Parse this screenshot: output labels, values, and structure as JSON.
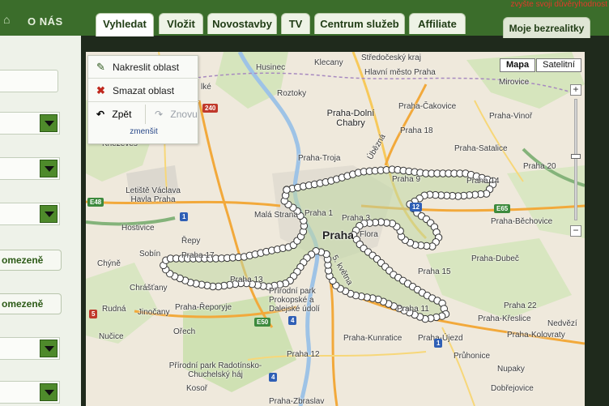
{
  "header": {
    "home_icon": "home-icon",
    "about": "O NÁS",
    "warning": "zvyšte svoji důvěryhodnost",
    "tabs": [
      {
        "label": "Vyhledat",
        "active": true
      },
      {
        "label": "Vložit"
      },
      {
        "label": "Novostavby"
      },
      {
        "label": "TV"
      },
      {
        "label": "Centrum služeb"
      },
      {
        "label": "Affiliate"
      },
      {
        "label": "Moje bezrealitky"
      }
    ]
  },
  "sidebar": {
    "button_1": "omezeně",
    "button_2": "omezeně"
  },
  "draw_panel": {
    "draw": "Nakreslit oblast",
    "delete": "Smazat oblast",
    "undo": "Zpět",
    "redo": "Znovu",
    "shrink": "zmenšit"
  },
  "map_type": {
    "map": "Mapa",
    "satellite": "Satelitní"
  },
  "zoom": {
    "level_fraction": 0.55
  },
  "map_labels": {
    "husinec": "Husinec",
    "klecany": "Klecany",
    "stredocesky": "Středočeský kraj",
    "hlavni_mesto": "Hlavní město Praha",
    "mirovice": "Mirovice",
    "roztoky": "Roztoky",
    "lke": "lké",
    "cakovice": "Praha-Čakovice",
    "dolni_chabry": "Praha-Dolní Chabry",
    "vinor": "Praha-Vinoř",
    "praha18": "Praha 18",
    "knezeves": "Kněževes",
    "troja": "Praha-Troja",
    "satalice": "Praha-Satalice",
    "praha9": "Praha 9",
    "praha14": "Praha 14",
    "praha20": "Praha 20",
    "letiste": "Letiště Václava Havla Praha",
    "mala_strana": "Malá Strana",
    "praha1": "Praha 1",
    "praha3": "Praha 3",
    "hostivice": "Hostivice",
    "praha": "Praha",
    "flora": "Flora",
    "bechovice": "Praha-Běchovice",
    "repy": "Řepy",
    "sobin": "Sobín",
    "praha17": "Praha 17",
    "chyne": "Chýně",
    "praha13": "Praha 13",
    "prirodni_park": "Přírodní park Prokopské a Dalejské údolí",
    "praha15": "Praha 15",
    "dubec": "Praha-Dubeč",
    "chrastany": "Chrášťany",
    "reporyje": "Praha-Řeporyje",
    "rudna": "Rudná",
    "jinocany": "Jinočany",
    "praha11": "Praha 11",
    "praha22": "Praha 22",
    "nucice": "Nučice",
    "orech": "Ořech",
    "kunratice": "Praha-Kunratice",
    "ujezd": "Praha-Újezd",
    "kreslice": "Praha-Křeslice",
    "kolovraty": "Praha-Kolovraty",
    "nedvezi": "Nedvězí",
    "praha12": "Praha 12",
    "pruhonice": "Průhonice",
    "radotin": "Přírodní park Radotínsko-Chuchelský háj",
    "nupaky": "Nupaky",
    "kosor": "Kosoř",
    "zbraslav": "Praha-Zbraslav",
    "dobrejovice": "Dobřejovice",
    "uberezni": "Úbězná",
    "kbelska": "5. května"
  },
  "road_shields": [
    "240",
    "E48",
    "1",
    "E65",
    "12",
    "5",
    "E50",
    "4",
    "1",
    "4"
  ]
}
